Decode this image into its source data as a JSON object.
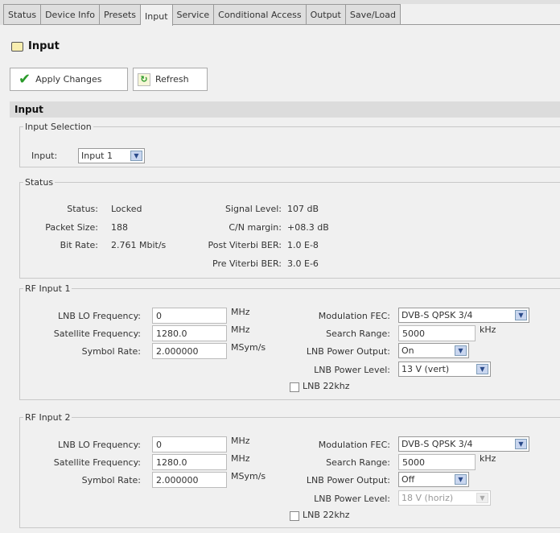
{
  "tabs": [
    "Status",
    "Device Info",
    "Presets",
    "Input",
    "Service",
    "Conditional Access",
    "Output",
    "Save/Load"
  ],
  "active_tab": "Input",
  "page_title": "Input",
  "toolbar": {
    "apply": "Apply Changes",
    "refresh": "Refresh"
  },
  "section_title": "Input",
  "input_selection": {
    "legend": "Input Selection",
    "label": "Input:",
    "value": "Input 1"
  },
  "status": {
    "legend": "Status",
    "left": [
      {
        "label": "Status:",
        "value": "Locked"
      },
      {
        "label": "Packet Size:",
        "value": "188"
      },
      {
        "label": "Bit Rate:",
        "value": "2.761 Mbit/s"
      }
    ],
    "right": [
      {
        "label": "Signal Level:",
        "value": "107 dB"
      },
      {
        "label": "C/N margin:",
        "value": "+08.3 dB"
      },
      {
        "label": "Post Viterbi BER:",
        "value": "1.0 E-8"
      },
      {
        "label": "Pre Viterbi BER:",
        "value": "3.0 E-6"
      }
    ]
  },
  "rf": [
    {
      "legend": "RF Input 1",
      "lnb_lo_label": "LNB LO Frequency:",
      "lnb_lo": "0",
      "sat_label": "Satellite Frequency:",
      "sat": "1280.0",
      "sym_label": "Symbol Rate:",
      "sym": "2.000000",
      "mhz": "MHz",
      "msym": "MSym/s",
      "fec_label": "Modulation FEC:",
      "fec": "DVB-S QPSK 3/4",
      "range_label": "Search Range:",
      "range": "5000",
      "khz": "kHz",
      "pwr_out_label": "LNB Power Output:",
      "pwr_out": "On",
      "pwr_lvl_label": "LNB Power Level:",
      "pwr_lvl": "13 V (vert)",
      "khz22": "LNB 22khz"
    },
    {
      "legend": "RF Input 2",
      "lnb_lo_label": "LNB LO Frequency:",
      "lnb_lo": "0",
      "sat_label": "Satellite Frequency:",
      "sat": "1280.0",
      "sym_label": "Symbol Rate:",
      "sym": "2.000000",
      "mhz": "MHz",
      "msym": "MSym/s",
      "fec_label": "Modulation FEC:",
      "fec": "DVB-S QPSK 3/4",
      "range_label": "Search Range:",
      "range": "5000",
      "khz": "kHz",
      "pwr_out_label": "LNB Power Output:",
      "pwr_out": "Off",
      "pwr_lvl_label": "LNB Power Level:",
      "pwr_lvl": "18 V (horiz)",
      "khz22": "LNB 22khz"
    }
  ]
}
